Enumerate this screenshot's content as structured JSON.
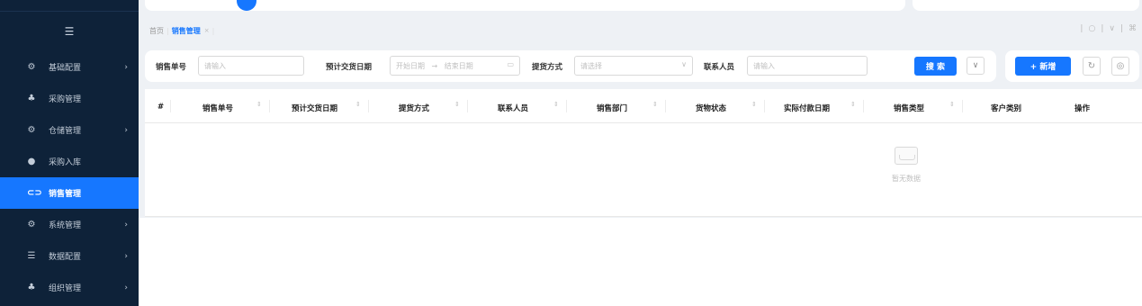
{
  "sidebar": {
    "collapse_icon": "menu-fold-icon",
    "items": [
      {
        "label": "基础配置",
        "icon": "gear-icon",
        "arrow": true,
        "active": false
      },
      {
        "label": "采购管理",
        "icon": "org-icon",
        "arrow": false,
        "active": false
      },
      {
        "label": "仓储管理",
        "icon": "gear-icon",
        "arrow": true,
        "active": false
      },
      {
        "label": "采购入库",
        "icon": "circle-icon",
        "arrow": false,
        "active": false
      },
      {
        "label": "销售管理",
        "icon": "link-icon",
        "arrow": false,
        "active": true
      },
      {
        "label": "系统管理",
        "icon": "gear-icon",
        "arrow": true,
        "active": false
      },
      {
        "label": "数据配置",
        "icon": "list-icon",
        "arrow": true,
        "active": false
      },
      {
        "label": "组织管理",
        "icon": "org-icon",
        "arrow": true,
        "active": false
      }
    ]
  },
  "tabs": {
    "home": "首页",
    "active": "销售管理",
    "close": "×"
  },
  "filter": {
    "order_no_label": "销售单号",
    "order_no_placeholder": "请输入",
    "delivery_date_label": "预计交货日期",
    "start_date": "开始日期",
    "date_arrow": "→",
    "end_date": "结束日期",
    "pickup_label": "提货方式",
    "pickup_placeholder": "请选择",
    "contact_label": "联系人员",
    "contact_placeholder": "请输入",
    "search_button": "搜 索"
  },
  "actions": {
    "add_button": "+ 新增"
  },
  "table": {
    "columns": [
      "#",
      "销售单号",
      "预计交货日期",
      "提货方式",
      "联系人员",
      "销售部门",
      "货物状态",
      "实际付款日期",
      "销售类型",
      "客户类别",
      "操作"
    ],
    "empty_text": "暂无数据"
  },
  "colors": {
    "primary": "#1677ff",
    "sidebar_bg": "#0e2239"
  }
}
